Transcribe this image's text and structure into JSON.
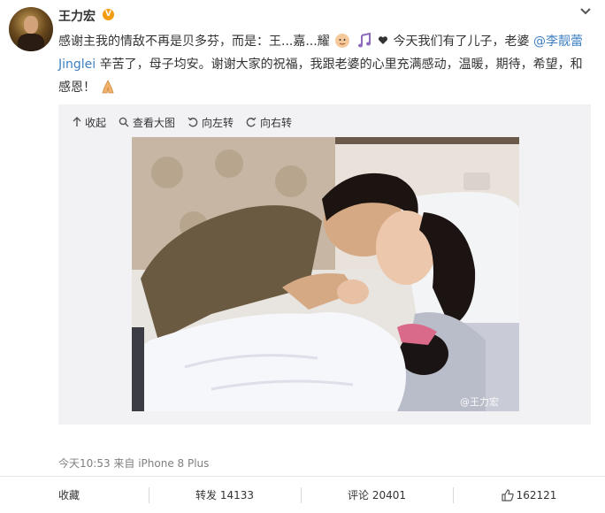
{
  "user": {
    "name": "王力宏",
    "badge": "V"
  },
  "post": {
    "text_1": "感谢主我的情敌不再是贝多芬，而是：王...嘉...耀",
    "text_2": "今天我们有了儿子，老婆",
    "mention": "@李靓蕾 Jinglei",
    "text_3": " 辛苦了，母子均安。谢谢大家的祝福，我跟老婆的心里充满感动，温暖，期待，希望，和感恩！"
  },
  "toolbar": {
    "collapse": "收起",
    "view_large": "查看大图",
    "rotate_left": "向左转",
    "rotate_right": "向右转"
  },
  "photo": {
    "watermark": "@王力宏"
  },
  "meta": {
    "time_source": "今天10:53 来自 iPhone 8 Plus"
  },
  "actions": {
    "favorite": "收藏",
    "repost": "转发 14133",
    "comment": "评论 20401",
    "like_count": "162121"
  }
}
